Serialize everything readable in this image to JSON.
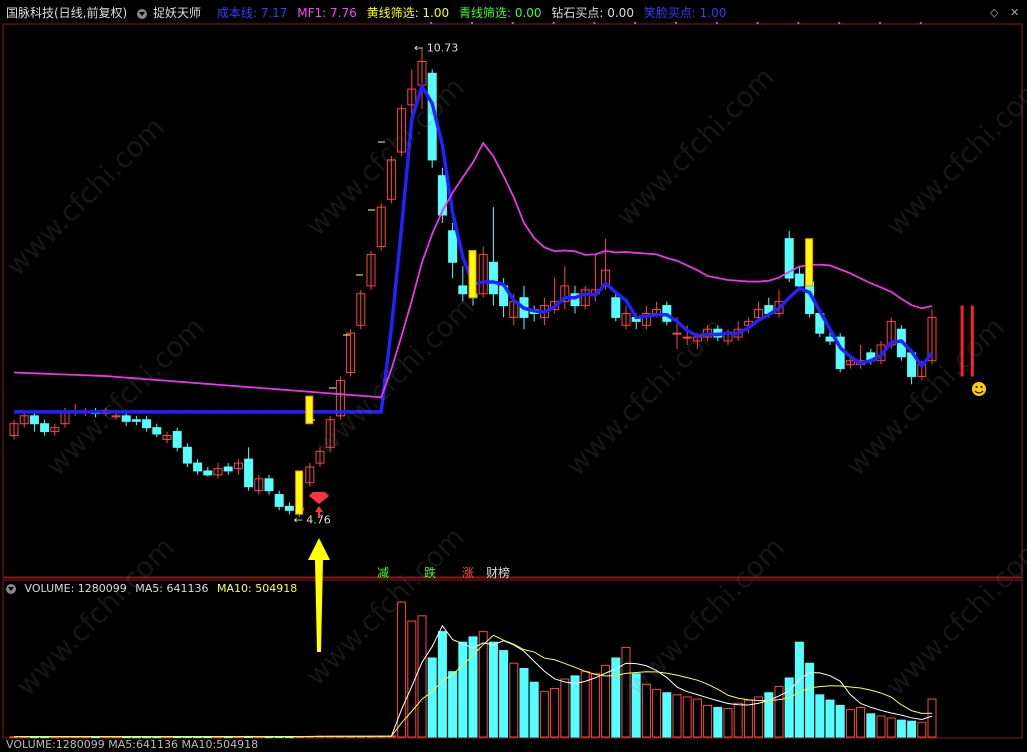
{
  "header": {
    "stock": "国脉科技(日线,前复权)",
    "indicator": "捉妖天师",
    "items": [
      {
        "label": "成本线: 7.17",
        "color": "#3a3aff"
      },
      {
        "label": "MF1: 7.76",
        "color": "#ff44ff"
      },
      {
        "label": "黄线筛选: 1.00",
        "color": "#ffff00"
      },
      {
        "label": "青线筛选: 0.00",
        "color": "#33ff33"
      },
      {
        "label": "钻石买点: 0.00",
        "color": "#dddddd"
      },
      {
        "label": "笑脸买点: 1.00",
        "color": "#3a3aff"
      }
    ]
  },
  "volume_header": {
    "items": [
      {
        "label": "VOLUME: 1280099",
        "color": "#dddddd"
      },
      {
        "label": "MA5: 641136",
        "color": "#dddddd"
      },
      {
        "label": "MA10: 504918",
        "color": "#ffff44"
      }
    ],
    "repeat": "VOLUME:1280099 MA5:641136 MA10:504918"
  },
  "annotations": {
    "high": "10.73",
    "low": "4.76",
    "signals": [
      {
        "label": "减",
        "color": "#33ff33"
      },
      {
        "label": "跌",
        "color": "#33ff33"
      },
      {
        "label": "涨",
        "color": "#ff4444"
      },
      {
        "label": "财榜",
        "color": "#dddddd"
      }
    ]
  },
  "watermark": "www.cfchi.com",
  "colors": {
    "up": "#ff4444",
    "down": "#55ffff",
    "cost": "#2222ff",
    "mf1": "#ee33ee",
    "ma5": "#ffffff",
    "ma10": "#ffff44",
    "yellow": "#ffff00"
  },
  "chart_data": {
    "type": "candlestick",
    "high": 10.73,
    "low": 4.76,
    "candles": [
      [
        5.8,
        5.95,
        6.0,
        5.75
      ],
      [
        5.95,
        6.05,
        6.1,
        5.9
      ],
      [
        6.05,
        5.95,
        6.1,
        5.85
      ],
      [
        5.95,
        5.85,
        6.0,
        5.8
      ],
      [
        5.85,
        5.9,
        5.95,
        5.8
      ],
      [
        5.95,
        6.1,
        6.15,
        5.9
      ],
      [
        6.1,
        6.1,
        6.2,
        6.05
      ],
      [
        6.1,
        6.1,
        6.15,
        6.05
      ],
      [
        6.1,
        6.08,
        6.15,
        6.03
      ],
      [
        6.08,
        6.12,
        6.15,
        6.05
      ],
      [
        6.05,
        6.05,
        6.1,
        6.0
      ],
      [
        6.05,
        5.98,
        6.08,
        5.92
      ],
      [
        6.0,
        5.98,
        6.05,
        5.93
      ],
      [
        6.0,
        5.9,
        6.05,
        5.85
      ],
      [
        5.9,
        5.82,
        5.95,
        5.78
      ],
      [
        5.75,
        5.8,
        5.85,
        5.7
      ],
      [
        5.85,
        5.65,
        5.9,
        5.6
      ],
      [
        5.65,
        5.45,
        5.7,
        5.4
      ],
      [
        5.45,
        5.35,
        5.5,
        5.3
      ],
      [
        5.35,
        5.3,
        5.4,
        5.28
      ],
      [
        5.3,
        5.38,
        5.45,
        5.25
      ],
      [
        5.4,
        5.35,
        5.45,
        5.3
      ],
      [
        5.38,
        5.45,
        5.5,
        5.3
      ],
      [
        5.5,
        5.15,
        5.65,
        5.1
      ],
      [
        5.1,
        5.25,
        5.3,
        5.05
      ],
      [
        5.25,
        5.1,
        5.3,
        5.05
      ],
      [
        5.05,
        4.9,
        5.1,
        4.85
      ],
      [
        4.9,
        4.85,
        4.95,
        4.8
      ],
      [
        4.85,
        4.88,
        4.9,
        4.76
      ],
      [
        5.2,
        5.4,
        5.45,
        5.15
      ],
      [
        5.45,
        5.6,
        5.65,
        5.4
      ],
      [
        5.65,
        6.0,
        6.05,
        5.6
      ],
      [
        6.05,
        6.5,
        6.55,
        6.0
      ],
      [
        6.6,
        7.1,
        7.15,
        6.55
      ],
      [
        7.2,
        7.6,
        7.65,
        7.15
      ],
      [
        7.7,
        8.1,
        8.15,
        7.65
      ],
      [
        8.2,
        8.7,
        8.75,
        8.15
      ],
      [
        8.8,
        9.3,
        9.35,
        8.75
      ],
      [
        9.4,
        9.95,
        10.0,
        9.35
      ],
      [
        10.0,
        10.2,
        10.45,
        9.85
      ],
      [
        10.25,
        10.55,
        10.73,
        9.95
      ],
      [
        10.4,
        9.3,
        10.45,
        9.2
      ],
      [
        9.1,
        8.6,
        9.2,
        8.5
      ],
      [
        8.4,
        8.0,
        8.5,
        7.8
      ],
      [
        7.7,
        7.6,
        7.95,
        7.5
      ],
      [
        7.6,
        7.55,
        7.75,
        7.45
      ],
      [
        7.6,
        8.1,
        8.2,
        7.55
      ],
      [
        8.0,
        7.6,
        8.7,
        7.45
      ],
      [
        7.7,
        7.45,
        7.8,
        7.3
      ],
      [
        7.3,
        7.5,
        7.6,
        7.2
      ],
      [
        7.55,
        7.3,
        7.7,
        7.15
      ],
      [
        7.4,
        7.35,
        7.45,
        7.25
      ],
      [
        7.3,
        7.45,
        7.55,
        7.2
      ],
      [
        7.4,
        7.5,
        7.8,
        7.35
      ],
      [
        7.5,
        7.7,
        7.95,
        7.4
      ],
      [
        7.6,
        7.45,
        7.7,
        7.35
      ],
      [
        7.45,
        7.65,
        7.7,
        7.4
      ],
      [
        7.6,
        7.65,
        8.1,
        7.5
      ],
      [
        7.7,
        7.9,
        8.3,
        7.65
      ],
      [
        7.55,
        7.3,
        7.6,
        7.25
      ],
      [
        7.2,
        7.35,
        7.45,
        7.15
      ],
      [
        7.3,
        7.25,
        7.35,
        7.15
      ],
      [
        7.2,
        7.35,
        7.45,
        7.15
      ],
      [
        7.35,
        7.4,
        7.5,
        7.3
      ],
      [
        7.45,
        7.25,
        7.5,
        7.2
      ],
      [
        7.1,
        7.1,
        7.3,
        6.9
      ],
      [
        7.05,
        7.05,
        7.2,
        6.95
      ],
      [
        7.0,
        7.05,
        7.1,
        6.9
      ],
      [
        7.05,
        7.15,
        7.2,
        7.0
      ],
      [
        7.15,
        7.05,
        7.2,
        7.0
      ],
      [
        7.0,
        7.1,
        7.15,
        6.95
      ],
      [
        7.05,
        7.15,
        7.25,
        7.0
      ],
      [
        7.2,
        7.25,
        7.3,
        7.1
      ],
      [
        7.3,
        7.4,
        7.5,
        7.25
      ],
      [
        7.45,
        7.35,
        7.55,
        7.3
      ],
      [
        7.35,
        7.5,
        7.65,
        7.3
      ],
      [
        8.3,
        7.8,
        8.4,
        7.75
      ],
      [
        7.85,
        7.7,
        7.95,
        7.65
      ],
      [
        7.75,
        7.35,
        7.8,
        7.3
      ],
      [
        7.35,
        7.1,
        7.4,
        7.05
      ],
      [
        7.05,
        7.0,
        7.15,
        6.95
      ],
      [
        7.05,
        6.65,
        7.1,
        6.6
      ],
      [
        6.7,
        6.75,
        6.8,
        6.65
      ],
      [
        6.7,
        6.75,
        6.95,
        6.65
      ],
      [
        6.85,
        6.75,
        6.9,
        6.7
      ],
      [
        6.75,
        6.95,
        7.0,
        6.7
      ],
      [
        6.95,
        7.25,
        7.3,
        6.9
      ],
      [
        7.15,
        6.8,
        7.2,
        6.75
      ],
      [
        6.85,
        6.55,
        6.9,
        6.45
      ],
      [
        6.55,
        6.7,
        6.75,
        6.5
      ],
      [
        6.75,
        7.3,
        7.4,
        6.7
      ]
    ],
    "volume": [
      20,
      22,
      18,
      20,
      19,
      25,
      22,
      18,
      20,
      22,
      21,
      20,
      19,
      18,
      20,
      22,
      25,
      30,
      26,
      22,
      20,
      22,
      24,
      35,
      28,
      26,
      30,
      25,
      28,
      40,
      55,
      60,
      45,
      40,
      45,
      50,
      55,
      65,
      1280099,
      1100000,
      1150000,
      750000,
      1000000,
      620000,
      900000,
      950000,
      1000000,
      900000,
      820000,
      700000,
      650000,
      520000,
      430000,
      460000,
      550000,
      580000,
      620000,
      600000,
      680000,
      750000,
      850000,
      600000,
      500000,
      450000,
      420000,
      400000,
      380000,
      360000,
      300000,
      280000,
      270000,
      320000,
      350000,
      380000,
      420000,
      480000,
      560000,
      900000,
      700000,
      400000,
      350000,
      300000,
      260000,
      280000,
      220000,
      200000,
      180000,
      160000,
      150000,
      140000,
      360000
    ]
  }
}
